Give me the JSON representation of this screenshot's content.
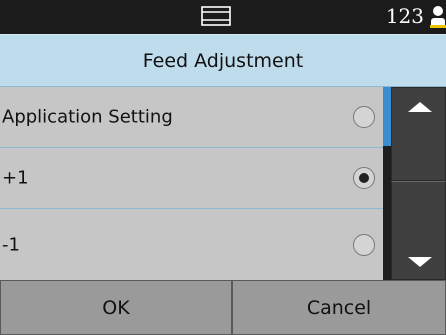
{
  "status_bar": {
    "icon": "scanner-icon",
    "counter": "123",
    "user_icon": "user-icon"
  },
  "title": "Feed Adjustment",
  "options": [
    {
      "label": "Application Setting",
      "selected": false
    },
    {
      "label": "+1",
      "selected": true
    },
    {
      "label": "-1",
      "selected": false
    }
  ],
  "scroll": {
    "up_icon": "arrow-up-icon",
    "down_icon": "arrow-down-icon"
  },
  "buttons": {
    "ok": "OK",
    "cancel": "Cancel"
  },
  "colors": {
    "title_bar": "#bfdced",
    "list_row": "#c6c6c6",
    "scroll_thumb": "#3a8ed0",
    "button_bg": "#9a9a9a"
  }
}
